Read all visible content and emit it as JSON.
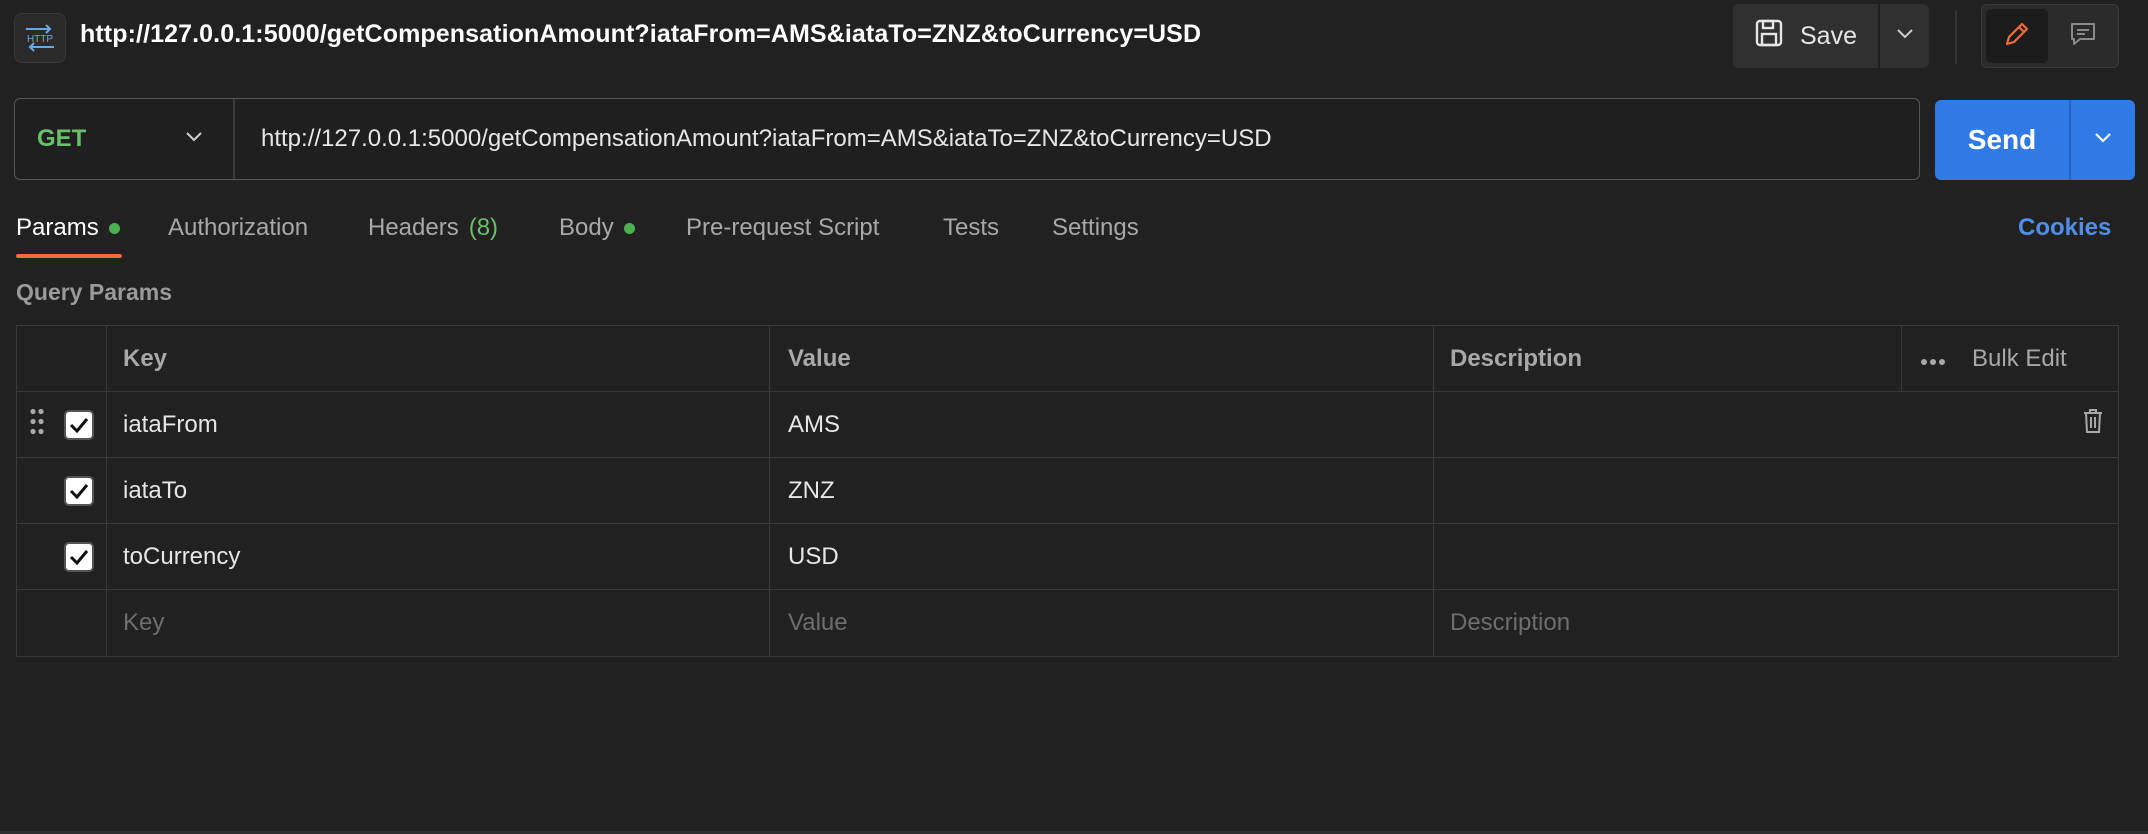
{
  "header": {
    "icon_label": "HTTP",
    "title": "http://127.0.0.1:5000/getCompensationAmount?iataFrom=AMS&iataTo=ZNZ&toCurrency=USD",
    "save_label": "Save"
  },
  "request": {
    "method": "GET",
    "url": "http://127.0.0.1:5000/getCompensationAmount?iataFrom=AMS&iataTo=ZNZ&toCurrency=USD",
    "send_label": "Send"
  },
  "tabs": [
    {
      "label": "Params",
      "dot": true,
      "active": true
    },
    {
      "label": "Authorization"
    },
    {
      "label": "Headers",
      "count": "(8)"
    },
    {
      "label": "Body",
      "dot": true
    },
    {
      "label": "Pre-request Script"
    },
    {
      "label": "Tests"
    },
    {
      "label": "Settings"
    }
  ],
  "cookies_label": "Cookies",
  "query_params": {
    "section_label": "Query Params",
    "headers": {
      "key": "Key",
      "value": "Value",
      "description": "Description",
      "bulk_edit": "Bulk Edit"
    },
    "rows": [
      {
        "key": "iataFrom",
        "value": "AMS",
        "checked": true
      },
      {
        "key": "iataTo",
        "value": "ZNZ",
        "checked": true
      },
      {
        "key": "toCurrency",
        "value": "USD",
        "checked": true
      }
    ],
    "placeholders": {
      "key": "Key",
      "value": "Value",
      "description": "Description"
    }
  },
  "colors": {
    "accent_send": "#2f7ae5",
    "method_get": "#6abf69",
    "tab_underline": "#f26b3a",
    "cookies_link": "#4f8fe8"
  }
}
